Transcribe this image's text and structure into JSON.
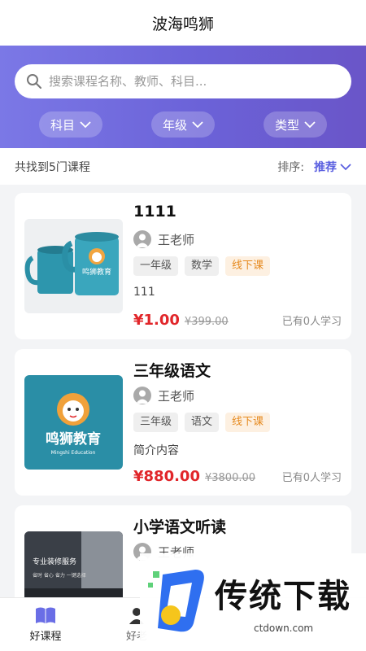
{
  "header": {
    "title": "波海鸣狮"
  },
  "search": {
    "placeholder": "搜索课程名称、教师、科目..."
  },
  "filters": [
    {
      "label": "科目"
    },
    {
      "label": "年级"
    },
    {
      "label": "类型"
    }
  ],
  "results": {
    "count_text": "共找到5门课程",
    "sort_label": "排序:",
    "sort_value": "推荐"
  },
  "courses": [
    {
      "title": "1111",
      "teacher": "王老师",
      "tags": [
        "一年级",
        "数学",
        "线下课"
      ],
      "description": "111",
      "price": "¥1.00",
      "original_price": "¥399.00",
      "learners": "已有0人学习",
      "thumb_text": "鸣狮教育",
      "thumb_sub": "Mingshi Education"
    },
    {
      "title": "三年级语文",
      "teacher": "王老师",
      "tags": [
        "三年级",
        "语文",
        "线下课"
      ],
      "description": "简介内容",
      "price": "¥880.00",
      "original_price": "¥3800.00",
      "learners": "已有0人学习",
      "thumb_text": "鸣狮教育",
      "thumb_sub": "Mingshi Education"
    },
    {
      "title": "小学语文听读",
      "teacher": "王老师",
      "thumb_text": "专业装修服务",
      "thumb_sub": "省时 省心 省力 一键选择"
    }
  ],
  "tabbar": [
    {
      "label": "好课程",
      "icon": "book-icon",
      "active": true
    },
    {
      "label": "好老",
      "icon": "teacher-icon",
      "active": false
    }
  ],
  "watermark": {
    "brand": "传统下载",
    "url": "ctdown.com"
  },
  "colors": {
    "accent": "#5a5fe0",
    "price": "#e1262a",
    "tag_orange": "#e68a1f",
    "hero_start": "#7b78e6",
    "hero_end": "#6a55c8"
  }
}
